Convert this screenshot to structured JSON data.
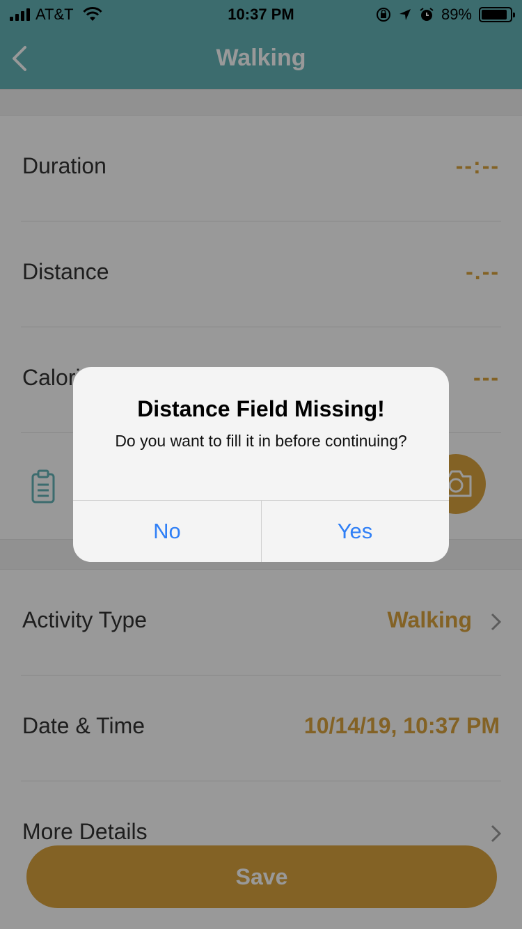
{
  "status_bar": {
    "carrier": "AT&T",
    "time": "10:37 PM",
    "battery": "89%",
    "battery_level": 0.89,
    "icons": [
      "signal-icon",
      "wifi-icon",
      "orientation-lock-icon",
      "location-icon",
      "alarm-icon",
      "battery-icon"
    ]
  },
  "nav": {
    "title": "Walking",
    "back_icon": "chevron-left-icon"
  },
  "fields": [
    {
      "label": "Duration",
      "value": "--:--"
    },
    {
      "label": "Distance",
      "value": "-.--"
    },
    {
      "label": "Calories",
      "value": "---"
    }
  ],
  "note_row": {
    "clipboard_icon": "clipboard-icon",
    "camera_icon": "camera-icon"
  },
  "details": [
    {
      "label": "Activity Type",
      "value": "Walking"
    },
    {
      "label": "Date & Time",
      "value": "10/14/19, 10:37 PM"
    },
    {
      "label": "More Details",
      "value": ""
    }
  ],
  "save_label": "Save",
  "dialog": {
    "title": "Distance Field Missing!",
    "message": "Do you want to fill it in before continuing?",
    "no_label": "No",
    "yes_label": "Yes"
  },
  "colors": {
    "header": "#64b5b8",
    "accent": "#dba43e",
    "dialog_button": "#2f7ff6"
  }
}
